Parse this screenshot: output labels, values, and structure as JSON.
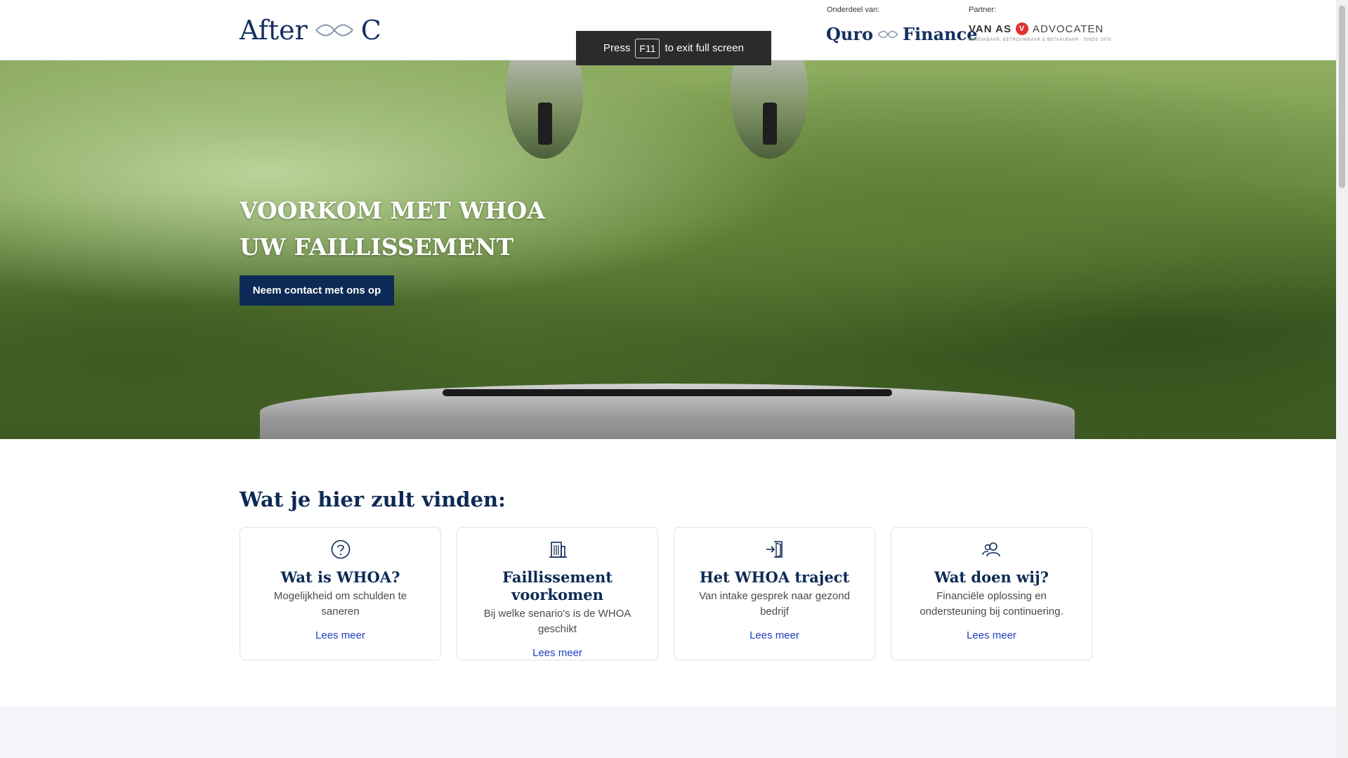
{
  "header": {
    "logo_left": "After",
    "logo_right": "C",
    "part_of_label": "Onderdeel van:",
    "part_of_left": "Quro",
    "part_of_right": "Finance",
    "partner_label": "Partner:",
    "partner_name_bold": "VAN AS",
    "partner_name": "ADVOCATEN",
    "partner_tagline": "BEREIKBAAR, BETROUWBAAR & BETAALBAAR · SINDS 1976"
  },
  "fullscreen_notice": {
    "before": "Press",
    "key": "F11",
    "after": "to exit full screen"
  },
  "hero": {
    "title_line1": "VOORKOM MET WHOA",
    "title_line2": "UW FAILLISSEMENT",
    "cta_label": "Neem contact met ons op"
  },
  "section": {
    "title": "Wat je hier zult vinden:",
    "cards": [
      {
        "icon": "question-circle-icon",
        "title": "Wat is WHOA?",
        "text": "Mogelijkheid om schulden te saneren",
        "link": "Lees meer"
      },
      {
        "icon": "building-icon",
        "title": "Faillissement voorkomen",
        "text": "Bij welke senario's is de WHOA geschikt",
        "link": "Lees meer"
      },
      {
        "icon": "sign-in-door-icon",
        "title": "Het WHOA traject",
        "text": "Van intake gesprek naar gezond bedrijf",
        "link": "Lees meer"
      },
      {
        "icon": "users-icon",
        "title": "Wat doen wij?",
        "text": "Financiële oplossing en ondersteuning bij continuering.",
        "link": "Lees meer"
      }
    ]
  },
  "colors": {
    "navy": "#0c2a55",
    "link": "#1f3fbf",
    "toast": "#2b2b2b"
  }
}
